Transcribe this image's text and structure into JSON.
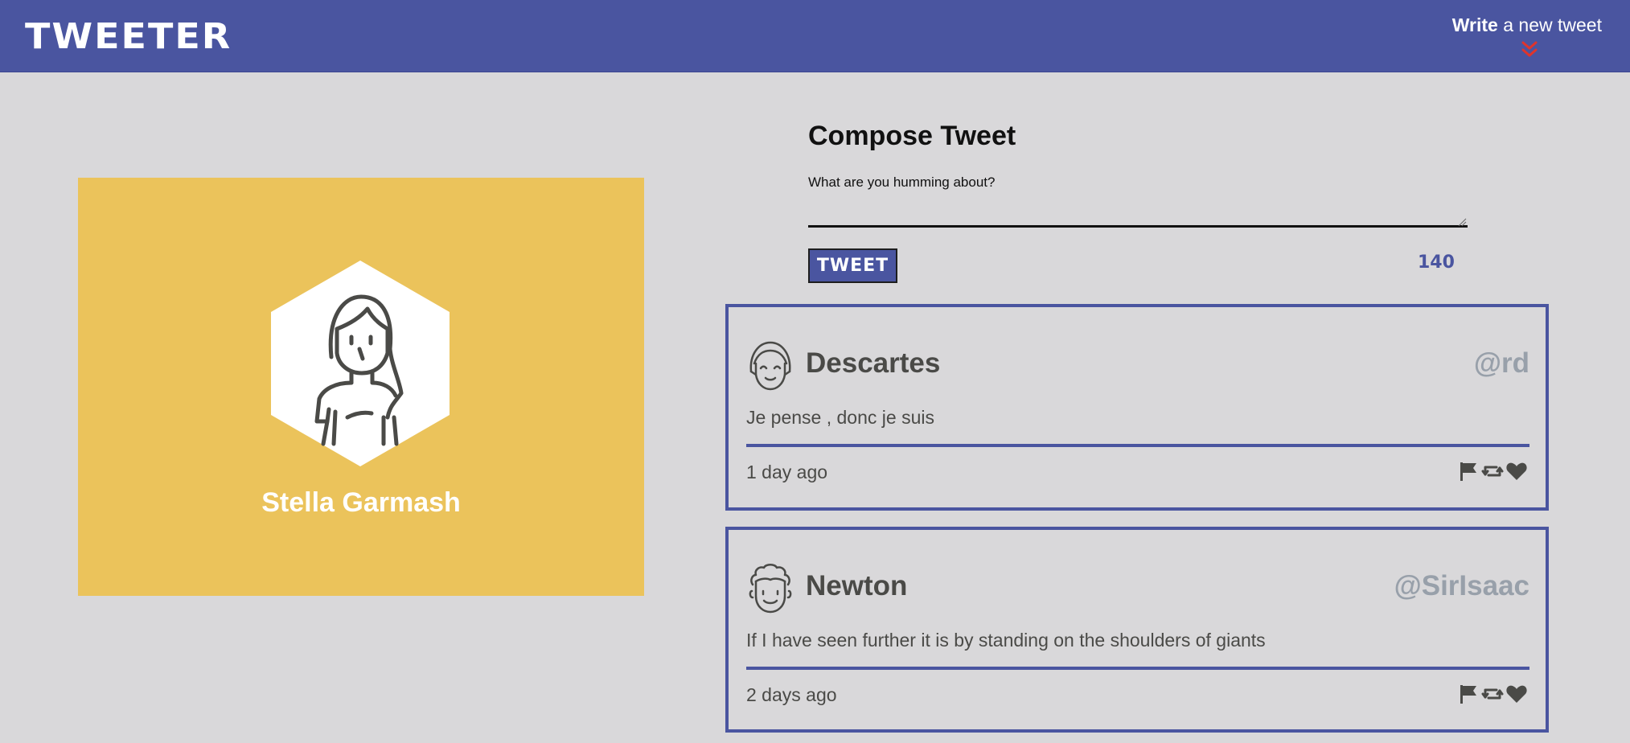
{
  "nav": {
    "brand": "TWEETER",
    "write_bold": "Write",
    "write_rest": " a new tweet",
    "chevron_color": "#e0342b",
    "icons": {
      "chevron": "double-chevron-down-icon"
    }
  },
  "profile": {
    "name": "Stella Garmash",
    "background": "#ebc35b",
    "icons": {
      "avatar": "woman-avatar-icon"
    }
  },
  "compose": {
    "title": "Compose Tweet",
    "placeholder": "What are you humming about?",
    "button": "TWEET",
    "counter": "140"
  },
  "tweets": [
    {
      "name": "Descartes",
      "handle": "@rd",
      "content": "Je pense , donc je suis",
      "time": "1 day ago",
      "avatar_icon": "smiling-girl-avatar-icon"
    },
    {
      "name": "Newton",
      "handle": "@SirIsaac",
      "content": "If I have seen further it is by standing on the shoulders of giants",
      "time": "2 days ago",
      "avatar_icon": "curly-hair-man-avatar-icon"
    }
  ],
  "accent": "#4a55a0"
}
